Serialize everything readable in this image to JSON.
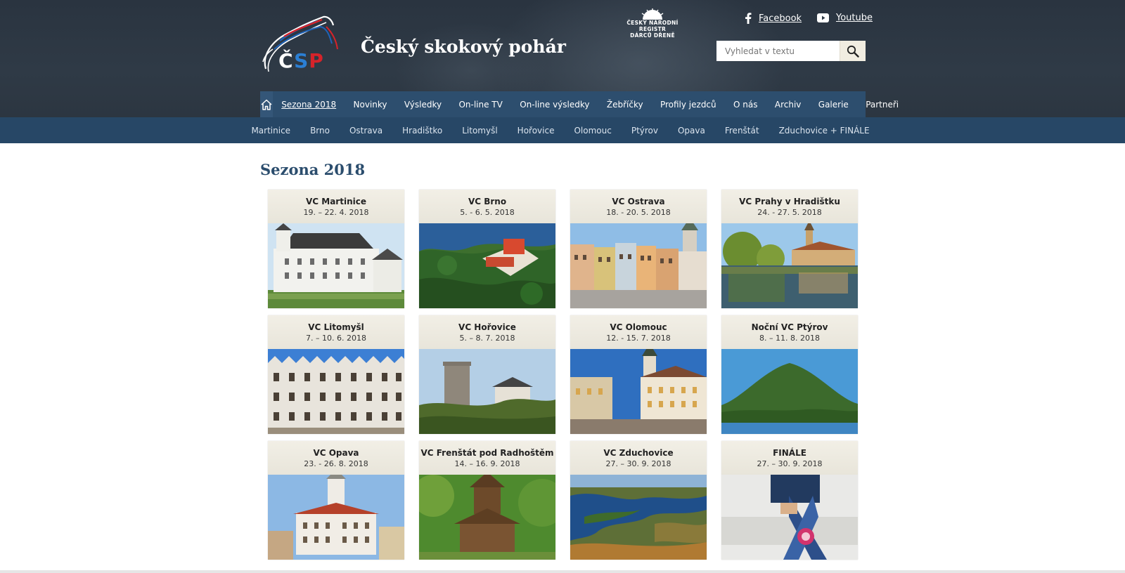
{
  "header": {
    "site_title": "Český skokový pohár",
    "logo_text": "ČSP",
    "registry_line1": "ČESKÝ NÁRODNÍ REGISTR",
    "registry_line2": "DÁRCŮ DŘENĚ",
    "facebook_label": "Facebook",
    "youtube_label": "Youtube",
    "search_placeholder": "Vyhledat v textu"
  },
  "main_nav": {
    "items": [
      {
        "label": "Sezona 2018",
        "active": true
      },
      {
        "label": "Novinky"
      },
      {
        "label": "Výsledky"
      },
      {
        "label": "On-line TV"
      },
      {
        "label": "On-line výsledky"
      },
      {
        "label": "Žebříčky"
      },
      {
        "label": "Profily jezdců"
      },
      {
        "label": "O nás"
      },
      {
        "label": "Archiv"
      },
      {
        "label": "Galerie"
      },
      {
        "label": "Partneři"
      }
    ]
  },
  "sub_nav": {
    "items": [
      "Martinice",
      "Brno",
      "Ostrava",
      "Hradištko",
      "Litomyšl",
      "Hořovice",
      "Olomouc",
      "Ptýrov",
      "Opava",
      "Frenštát",
      "Zduchovice + FINÁLE"
    ]
  },
  "main": {
    "title": "Sezona 2018",
    "events": [
      {
        "name": "VC Martinice",
        "date": "19. – 22. 4. 2018"
      },
      {
        "name": "VC Brno",
        "date": "5. - 6. 5. 2018"
      },
      {
        "name": "VC Ostrava",
        "date": "18. - 20. 5. 2018"
      },
      {
        "name": "VC Prahy v Hradištku",
        "date": "24. - 27. 5. 2018"
      },
      {
        "name": "VC Litomyšl",
        "date": "7. – 10. 6. 2018"
      },
      {
        "name": "VC Hořovice",
        "date": "5. – 8. 7. 2018"
      },
      {
        "name": "VC Olomouc",
        "date": "12. - 15. 7. 2018"
      },
      {
        "name": "Noční VC Ptýrov",
        "date": "8. – 11. 8. 2018"
      },
      {
        "name": "VC Opava",
        "date": "23. - 26. 8. 2018"
      },
      {
        "name": "VC Frenštát pod Radhoštěm",
        "date": "14. – 16. 9. 2018"
      },
      {
        "name": "VC Zduchovice",
        "date": "27. – 30. 9. 2018"
      },
      {
        "name": "FINÁLE",
        "date": "27. – 30. 9. 2018"
      }
    ]
  },
  "colors": {
    "header_bg": "#2f3a46",
    "nav_bg": "#2d4e6e",
    "subnav_bg": "#274766",
    "title_color": "#2b4d6d",
    "card_head_bg": "#ede9dc"
  }
}
